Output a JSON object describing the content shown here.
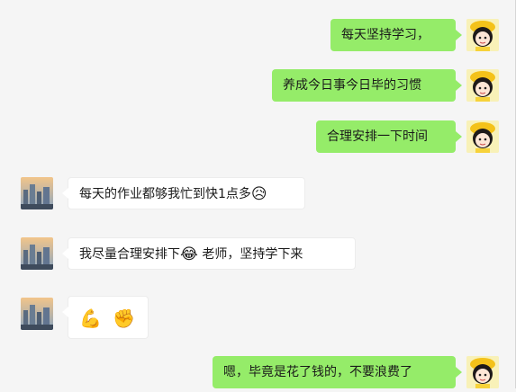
{
  "messages": [
    {
      "side": "right",
      "text": "每天坚持学习，"
    },
    {
      "side": "right",
      "text": "养成今日事今日毕的习惯"
    },
    {
      "side": "right",
      "text": "合理安排一下时间"
    },
    {
      "side": "left",
      "text": "每天的作业都够我忙到快1点多",
      "emoji_after": "😥"
    },
    {
      "side": "left",
      "text_before": "我尽量合理安排下",
      "emoji_mid": "😂",
      "text_after": " 老师，坚持学下来"
    },
    {
      "side": "left",
      "emojis": [
        "💪",
        "✊"
      ]
    },
    {
      "side": "right",
      "text": "嗯，毕竟是花了钱的，不要浪费了"
    }
  ],
  "icons": {
    "right_avatar": "cartoon-girl-avatar",
    "left_avatar": "city-skyline-avatar"
  },
  "colors": {
    "my_bubble": "#95ec69",
    "their_bubble": "#ffffff",
    "background": "#f5f5f5"
  }
}
